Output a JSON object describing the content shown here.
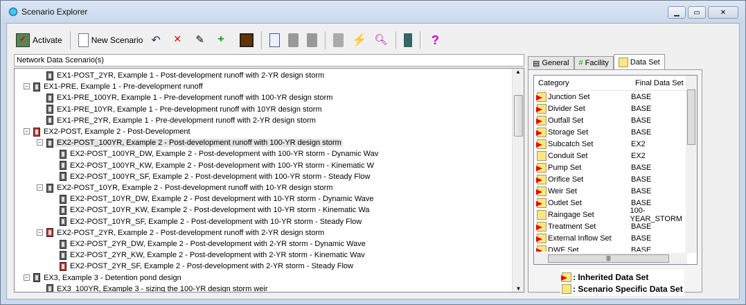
{
  "window": {
    "title": "Scenario Explorer"
  },
  "toolbar": {
    "activate": "Activate",
    "new_scenario": "New Scenario"
  },
  "tree": {
    "header": "Network Data Scenario(s)",
    "rows": [
      {
        "level": 2,
        "text": "EX1-POST_2YR, Example 1 - Post-development runoff with 2-YR design storm"
      },
      {
        "level": 1,
        "box": "-",
        "text": "EX1-PRE, Example 1 - Pre-development runoff"
      },
      {
        "level": 2,
        "text": "EX1-PRE_100YR, Example 1 - Pre-development runoff with 100-YR design storm"
      },
      {
        "level": 2,
        "text": "EX1-PRE_10YR, Example 1 - Pre-development runoff with 10YR design storm"
      },
      {
        "level": 2,
        "text": "EX1-PRE_2YR, Example 1 - Pre-development runoff with 2-YR design storm"
      },
      {
        "level": 1,
        "box": "-",
        "red": true,
        "text": "EX2-POST, Example 2 - Post-Development"
      },
      {
        "level": 2,
        "box": "-",
        "sel": true,
        "text": "EX2-POST_100YR, Example 2 - Post-development runoff with 100-YR design storm"
      },
      {
        "level": 3,
        "text": "EX2-POST_100YR_DW, Example 2 - Post-development with 100-YR storm - Dynamic Wav"
      },
      {
        "level": 3,
        "text": "EX2-POST_100YR_KW, Example 2 - Post-development with 100-YR storm - Kinematic W"
      },
      {
        "level": 3,
        "text": "EX2-POST_100YR_SF, Example 2 - Post-development with 100-YR storm - Steady Flow"
      },
      {
        "level": 2,
        "box": "-",
        "text": "EX2-POST_10YR, Example 2 - Post-development runoff with 10-YR design storm"
      },
      {
        "level": 3,
        "text": "EX2-POST_10YR_DW, Example 2 - Post development with 10-YR storm - Dynamic Wave"
      },
      {
        "level": 3,
        "text": "EX2-POST_10YR_KW, Example 2 - Post-development with 10-YR storm - Kinematic Wa"
      },
      {
        "level": 3,
        "text": "EX2-POST_10YR_SF, Example 2 - Post-development with 10-YR storm - Steady Flow"
      },
      {
        "level": 2,
        "box": "-",
        "red": true,
        "text": "EX2-POST_2YR, Example 2 - Post-development runoff with 2-YR design storm"
      },
      {
        "level": 3,
        "text": "EX2-POST_2YR_DW, Example 2 - Post-development with 2-YR storm - Dynamic Wave"
      },
      {
        "level": 3,
        "text": "EX2-POST_2YR_KW, Example 2 - Post-development with 2-YR storm - Kinematic Wav"
      },
      {
        "level": 3,
        "red": true,
        "text": "EX2-POST_2YR_SF, Example 2 - Post-development with 2-YR storm - Steady Flow"
      },
      {
        "level": 1,
        "box": "-",
        "text": "EX3, Example 3 - Detention pond design"
      },
      {
        "level": 2,
        "text": "EX3_100YR, Example 3 - sizing the 100-YR design storm weir"
      }
    ]
  },
  "tabs": {
    "general": "General",
    "facility": "Facility",
    "dataset": "Data Set"
  },
  "dataset": {
    "col1": "Category",
    "col2": "Final Data Set",
    "rows": [
      {
        "cat": "Junction Set",
        "val": "BASE",
        "inh": true
      },
      {
        "cat": "Divider Set",
        "val": "BASE",
        "inh": true
      },
      {
        "cat": "Outfall Set",
        "val": "BASE",
        "inh": true
      },
      {
        "cat": "Storage Set",
        "val": "BASE",
        "inh": true
      },
      {
        "cat": "Subcatch Set",
        "val": "EX2",
        "inh": true
      },
      {
        "cat": "Conduit Set",
        "val": "EX2",
        "inh": false
      },
      {
        "cat": "Pump Set",
        "val": "BASE",
        "inh": true
      },
      {
        "cat": "Orifice Set",
        "val": "BASE",
        "inh": true
      },
      {
        "cat": "Weir Set",
        "val": "BASE",
        "inh": true
      },
      {
        "cat": "Outlet Set",
        "val": "BASE",
        "inh": true
      },
      {
        "cat": "Raingage Set",
        "val": "100-YEAR_STORM",
        "inh": false
      },
      {
        "cat": "Treatment Set",
        "val": "BASE",
        "inh": true
      },
      {
        "cat": "External Inflow Set",
        "val": "BASE",
        "inh": true
      },
      {
        "cat": "DWF Set",
        "val": "BASE",
        "inh": true
      }
    ]
  },
  "legend": {
    "inherited": ": Inherited Data Set",
    "specific": ": Scenario Specific Data Set"
  }
}
